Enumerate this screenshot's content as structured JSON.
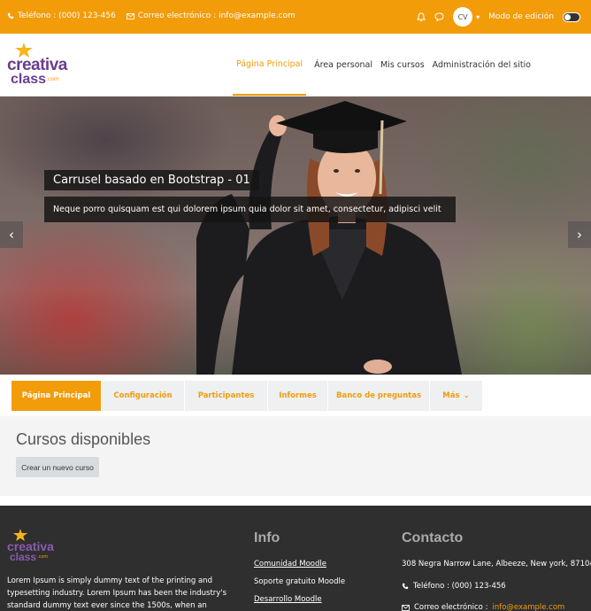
{
  "topbar": {
    "phone": "Teléfono : (000) 123-456",
    "email": "Correo electrónico : info@example.com",
    "avatar_initials": "CV",
    "edit_mode_label": "Modo de edición"
  },
  "header": {
    "logo": {
      "line1": "creativa",
      "line2": "class",
      "suffix": ".com"
    },
    "nav": [
      "Página Principal",
      "Área personal",
      "Mis cursos",
      "Administración del sitio"
    ]
  },
  "hero": {
    "caption_title": "Carrusel basado en Bootstrap - 01",
    "caption_text": "Neque porro quisquam est qui dolorem ipsum quia dolor sit amet, consectetur, adipisci velit",
    "prev_glyph": "‹",
    "next_glyph": "›"
  },
  "course_nav": {
    "tabs": [
      "Página Principal",
      "Configuración",
      "Participantes",
      "Informes",
      "Banco de preguntas"
    ],
    "more_label": "Más",
    "more_chevron": "⌄"
  },
  "content": {
    "heading": "Cursos disponibles",
    "new_course_button": "Crear un nuevo curso"
  },
  "footer": {
    "logo": {
      "line1": "creativa",
      "line2": "class",
      "suffix": ".com"
    },
    "about": "Lorem Ipsum is simply dummy text of the printing and typesetting industry. Lorem Ipsum has been the industry's standard dummy text ever since the 1500s, when an unknown printer took a galley",
    "info_title": "Info",
    "info_links": [
      "Comunidad Moodle",
      "Soporte gratuito Moodle",
      "Desarrollo Moodle"
    ],
    "contact_title": "Contacto",
    "address": "308 Negra Narrow Lane, Albeeze, New york, 87104",
    "phone": "Teléfono : (000) 123-456",
    "email_label": "Correo electrónico : ",
    "email_value": "info@example.com"
  },
  "colors": {
    "accent": "#f29c0a",
    "brand_purple": "#6b3d8f",
    "footer_bg": "#2f2f2f"
  },
  "icons": [
    "phone-icon",
    "envelope-icon",
    "bell-icon",
    "chat-icon",
    "chevron-down-icon"
  ]
}
